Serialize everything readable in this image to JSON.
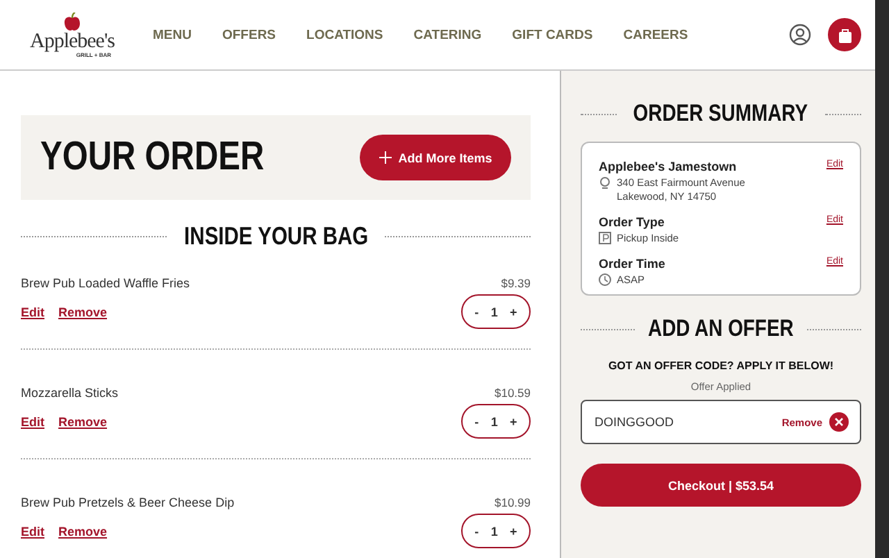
{
  "header": {
    "logo": {
      "name": "Applebee's",
      "tagline": "GRILL + BAR"
    },
    "nav": [
      {
        "label": "MENU"
      },
      {
        "label": "OFFERS"
      },
      {
        "label": "LOCATIONS"
      },
      {
        "label": "CATERING"
      },
      {
        "label": "GIFT CARDS"
      },
      {
        "label": "CAREERS"
      }
    ]
  },
  "order": {
    "title": "YOUR ORDER",
    "add_button": "Add More Items",
    "section_title": "INSIDE YOUR BAG",
    "items": [
      {
        "name": "Brew Pub Loaded Waffle Fries",
        "price": "$9.39",
        "edit": "Edit",
        "remove": "Remove",
        "minus": "-",
        "quantity": "1",
        "plus": "+"
      },
      {
        "name": "Mozzarella Sticks",
        "price": "$10.59",
        "edit": "Edit",
        "remove": "Remove",
        "minus": "-",
        "quantity": "1",
        "plus": "+"
      },
      {
        "name": "Brew Pub Pretzels & Beer Cheese Dip",
        "price": "$10.99",
        "edit": "Edit",
        "remove": "Remove",
        "minus": "-",
        "quantity": "1",
        "plus": "+"
      }
    ]
  },
  "summary": {
    "title": "ORDER SUMMARY",
    "details": [
      {
        "kind": "location",
        "label": "Applebee's Jamestown",
        "edit": "Edit",
        "lines": [
          "340 East Fairmount Avenue",
          "Lakewood, NY 14750"
        ]
      },
      {
        "kind": "type",
        "label": "Order Type",
        "edit": "Edit",
        "lines": [
          "Pickup Inside"
        ]
      },
      {
        "kind": "time",
        "label": "Order Time",
        "edit": "Edit",
        "lines": [
          "ASAP"
        ]
      }
    ],
    "offer_title": "ADD AN OFFER",
    "offer_prompt": "GOT AN OFFER CODE? APPLY IT BELOW!",
    "offer_status": "Offer Applied",
    "offer_code": "DOINGGOOD",
    "offer_remove": "Remove",
    "checkout": "Checkout | $53.54"
  }
}
